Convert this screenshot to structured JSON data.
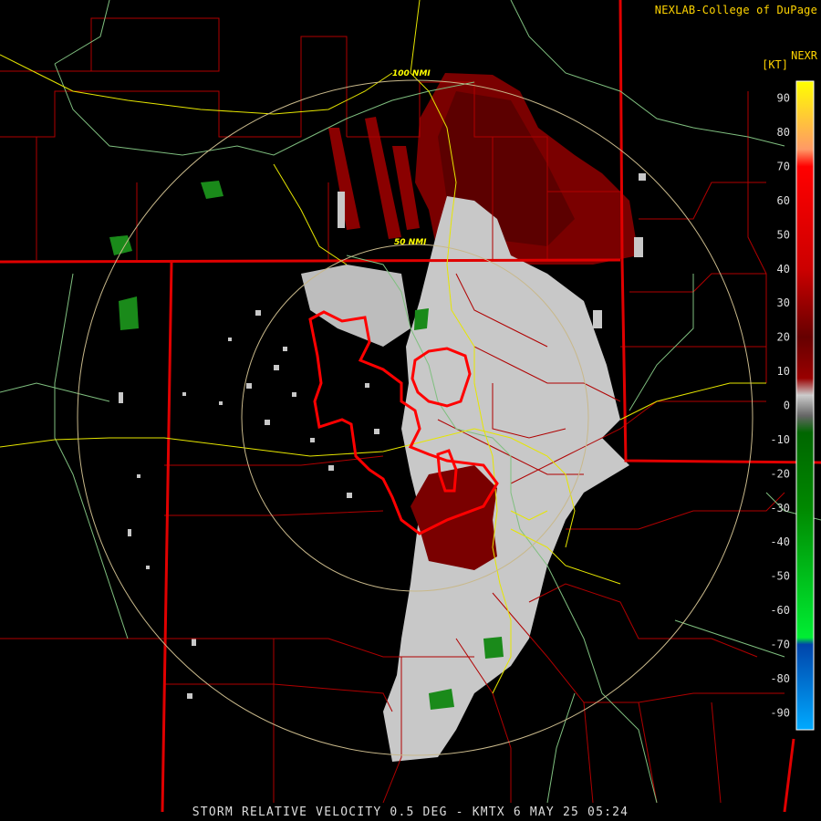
{
  "credit": "NEXLAB-College of DuPage",
  "product_code": "NEXR",
  "units": "[KT]",
  "footer": "STORM RELATIVE VELOCITY 0.5 DEG - KMTX 6 MAY 25 05:24",
  "range_rings": [
    {
      "label": "50 NMI"
    },
    {
      "label": "100 NMI"
    }
  ],
  "colorbar": {
    "ticks": [
      "90",
      "80",
      "70",
      "60",
      "50",
      "40",
      "30",
      "20",
      "10",
      "0",
      "-10",
      "-20",
      "-30",
      "-40",
      "-50",
      "-60",
      "-70",
      "-80",
      "-90"
    ],
    "stops": [
      {
        "v": 95,
        "c": "#ffff00"
      },
      {
        "v": 75,
        "c": "#ff9966"
      },
      {
        "v": 70,
        "c": "#ff0000"
      },
      {
        "v": 40,
        "c": "#cc0000"
      },
      {
        "v": 20,
        "c": "#660000"
      },
      {
        "v": 8,
        "c": "#990000"
      },
      {
        "v": 3,
        "c": "#cccccc"
      },
      {
        "v": -3,
        "c": "#666666"
      },
      {
        "v": -8,
        "c": "#006600"
      },
      {
        "v": -30,
        "c": "#008800"
      },
      {
        "v": -68,
        "c": "#00ee33"
      },
      {
        "v": -70,
        "c": "#0044aa"
      },
      {
        "v": -95,
        "c": "#00aaff"
      }
    ]
  },
  "colors": {
    "state_border": "#e00000",
    "county_border": "#b00000",
    "highway": "#e6e600",
    "river": "#7fbf7f",
    "range_ring": "#c8b88a",
    "warning_polygon": "#ff0000",
    "inbound": "#1a8a1a",
    "outbound": "#7a0000",
    "near_zero": "#c8c8c8"
  }
}
